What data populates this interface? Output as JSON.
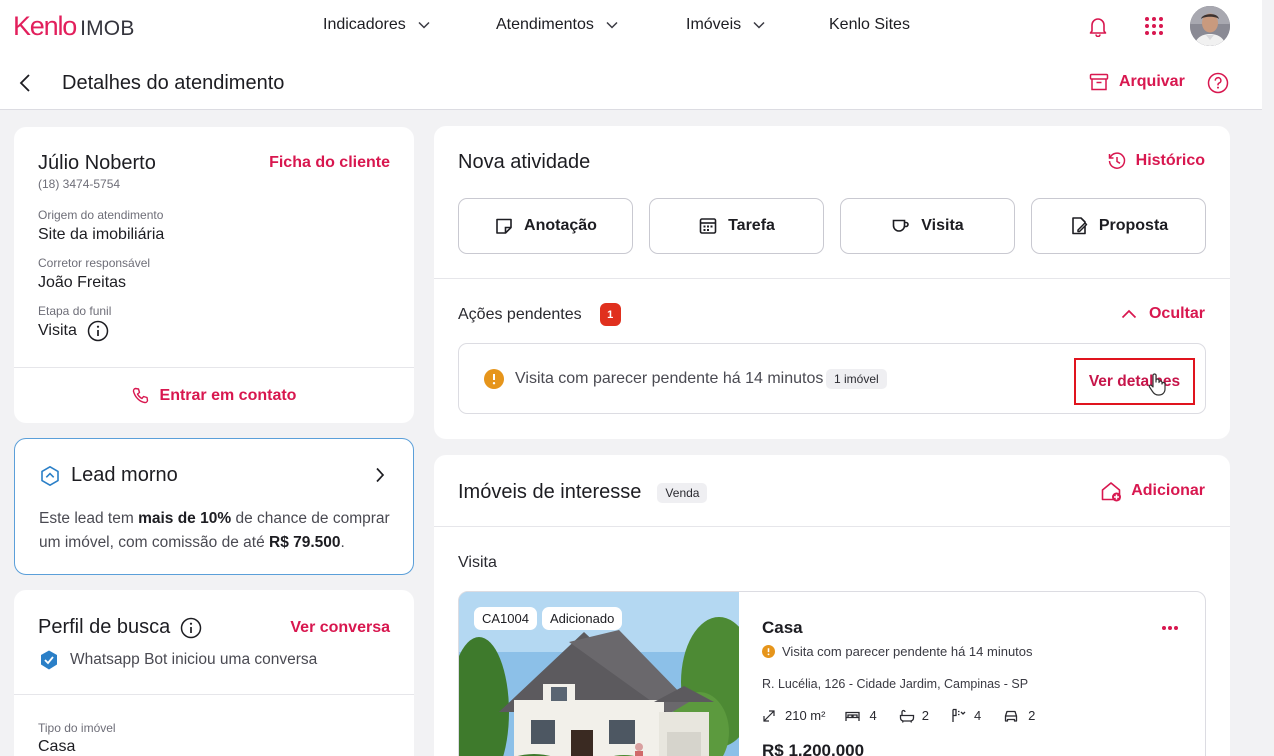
{
  "brand": {
    "primary": "Kenlo",
    "secondary": "IMOB",
    "accent_color": "#d8174f"
  },
  "nav": {
    "items": [
      {
        "label": "Indicadores",
        "has_dropdown": true
      },
      {
        "label": "Atendimentos",
        "has_dropdown": true
      },
      {
        "label": "Imóveis",
        "has_dropdown": true
      },
      {
        "label": "Kenlo Sites",
        "has_dropdown": false
      }
    ],
    "icons": [
      "bell-icon",
      "apps-grid-icon",
      "user-avatar"
    ]
  },
  "subheader": {
    "title": "Detalhes do atendimento",
    "archive_label": "Arquivar"
  },
  "client": {
    "name": "Júlio Noberto",
    "phone": "(18) 3474-5754",
    "profile_link": "Ficha do cliente",
    "origin_label": "Origem do atendimento",
    "origin_value": "Site da imobiliária",
    "broker_label": "Corretor responsável",
    "broker_value": "João Freitas",
    "funnel_label": "Etapa do funil",
    "funnel_value": "Visita",
    "contact_label": "Entrar em contato"
  },
  "lead": {
    "title": "Lead morno",
    "text_1": "Este lead tem ",
    "text_bold_1": "mais de 10%",
    "text_2": " de chance de comprar",
    "text_3": "um imóvel, com comissão de até ",
    "text_bold_2": "R$ 79.500",
    "text_4": "."
  },
  "search_profile": {
    "title": "Perfil de busca",
    "link": "Ver conversa",
    "bot_message": "Whatsapp Bot iniciou uma conversa",
    "property_type_label": "Tipo do imóvel",
    "property_type_value": "Casa"
  },
  "activity": {
    "title": "Nova atividade",
    "history_label": "Histórico",
    "buttons": [
      {
        "label": "Anotação",
        "icon": "note-icon"
      },
      {
        "label": "Tarefa",
        "icon": "calendar-icon"
      },
      {
        "label": "Visita",
        "icon": "visit-icon"
      },
      {
        "label": "Proposta",
        "icon": "proposal-icon"
      }
    ]
  },
  "pending": {
    "title": "Ações pendentes",
    "count": "1",
    "hide_label": "Ocultar",
    "item_text": "Visita com parecer pendente há 14 minutos",
    "item_badge": "1 imóvel",
    "item_link": "Ver detalhes"
  },
  "interest": {
    "title": "Imóveis de interesse",
    "type_badge": "Venda",
    "add_label": "Adicionar",
    "section_label": "Visita",
    "property": {
      "code": "CA1004",
      "status": "Adicionado",
      "type": "Casa",
      "pending_text": "Visita com parecer pendente há 14 minutos",
      "address": "R. Lucélia, 126 - Cidade Jardim, Campinas - SP",
      "area": "210 m²",
      "bedrooms": "4",
      "bathrooms": "2",
      "suites": "4",
      "parking": "2",
      "price": "R$ 1.200.000"
    }
  }
}
